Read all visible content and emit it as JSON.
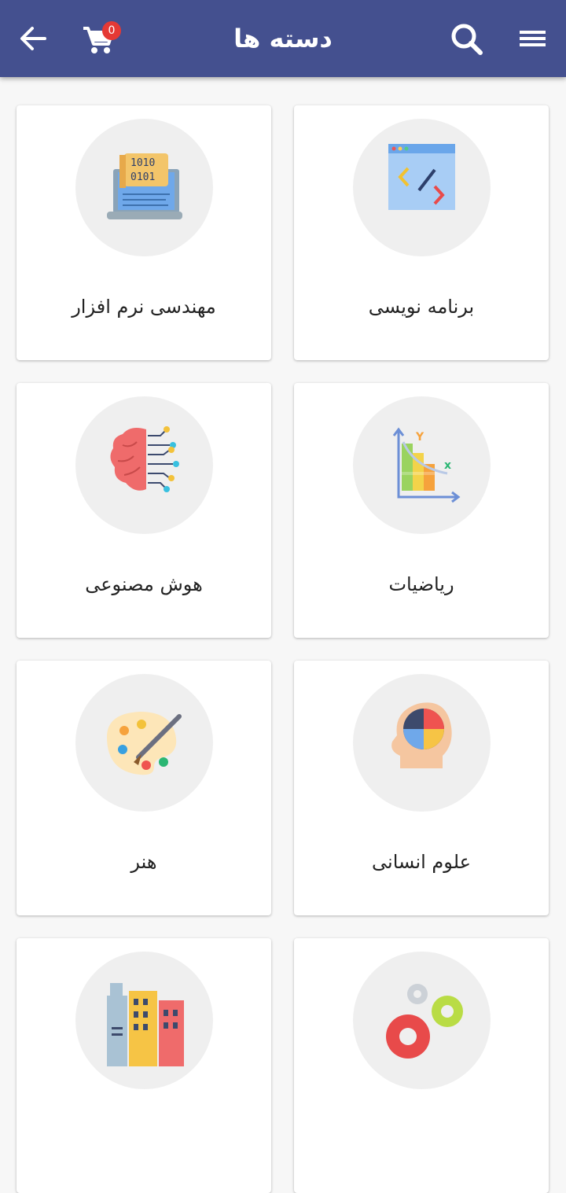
{
  "header": {
    "title": "دسته ها",
    "cart_count": "0",
    "icons": [
      "back-arrow-icon",
      "cart-icon",
      "search-icon",
      "menu-icon"
    ],
    "background_color": "#44508f"
  },
  "categories": [
    {
      "label": "برنامه نویسی",
      "icon": "code-window-icon"
    },
    {
      "label": "مهندسی نرم افزار",
      "icon": "binary-laptop-icon"
    },
    {
      "label": "ریاضیات",
      "icon": "math-graph-icon"
    },
    {
      "label": "هوش مصنوعی",
      "icon": "brain-circuit-icon"
    },
    {
      "label": "علوم انسانی",
      "icon": "head-puzzle-icon"
    },
    {
      "label": "هنر",
      "icon": "paint-palette-icon"
    },
    {
      "label": "",
      "icon": "gears-icon"
    },
    {
      "label": "",
      "icon": "buildings-icon"
    }
  ]
}
